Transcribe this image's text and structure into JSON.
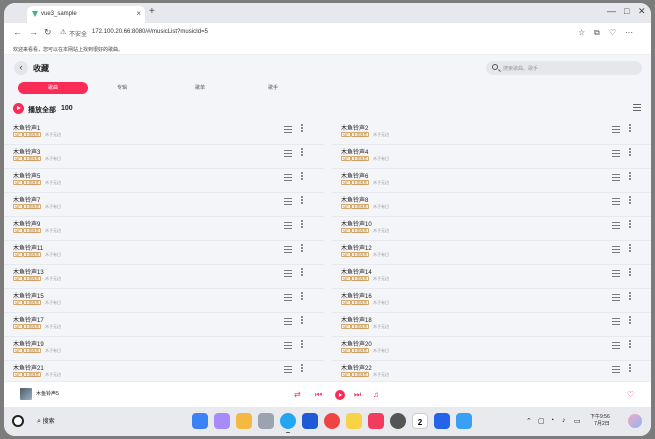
{
  "browser": {
    "tab_title": "vue3_sample",
    "tab_close": "×",
    "new_tab": "+",
    "insecure_label": "不安全",
    "url": "172.100.20.66:8080/#/musicList?musicId=5",
    "notice": "欢迎来看看，您可以在本网站上找到很好的歌曲。"
  },
  "header": {
    "back_glyph": "‹",
    "title": "收藏",
    "search_placeholder": "搜索歌曲、歌手"
  },
  "tabs": [
    "歌曲",
    "专辑",
    "歌单",
    "歌手"
  ],
  "play_all": {
    "label": "播放全部",
    "count": "100"
  },
  "songs": [
    {
      "name": "木鱼铃声1",
      "badge1": "VIP",
      "badge2": "无损音质",
      "album": "木子无边"
    },
    {
      "name": "木鱼铃声2",
      "badge1": "VIP",
      "badge2": "无损音质",
      "album": "木子无边"
    },
    {
      "name": "木鱼铃声3",
      "badge1": "VIP",
      "badge2": "无损音质",
      "album": "木子有日"
    },
    {
      "name": "木鱼铃声4",
      "badge1": "VIP",
      "badge2": "无损音质",
      "album": "木子有日"
    },
    {
      "name": "木鱼铃声5",
      "badge1": "VIP",
      "badge2": "无损音质",
      "album": "木子无边"
    },
    {
      "name": "木鱼铃声6",
      "badge1": "VIP",
      "badge2": "无损音质",
      "album": "木子无边"
    },
    {
      "name": "木鱼铃声7",
      "badge1": "VIP",
      "badge2": "无损音质",
      "album": "木子有日"
    },
    {
      "name": "木鱼铃声8",
      "badge1": "VIP",
      "badge2": "无损音质",
      "album": "木子有日"
    },
    {
      "name": "木鱼铃声9",
      "badge1": "VIP",
      "badge2": "无损音质",
      "album": "木子无边"
    },
    {
      "name": "木鱼铃声10",
      "badge1": "VIP",
      "badge2": "无损音质",
      "album": "木子无边"
    },
    {
      "name": "木鱼铃声11",
      "badge1": "VIP",
      "badge2": "无损音质",
      "album": "木子有日"
    },
    {
      "name": "木鱼铃声12",
      "badge1": "VIP",
      "badge2": "无损音质",
      "album": "木子有日"
    },
    {
      "name": "木鱼铃声13",
      "badge1": "VIP",
      "badge2": "无损音质",
      "album": "木子无边"
    },
    {
      "name": "木鱼铃声14",
      "badge1": "VIP",
      "badge2": "无损音质",
      "album": "木子无边"
    },
    {
      "name": "木鱼铃声15",
      "badge1": "VIP",
      "badge2": "无损音质",
      "album": "木子有日"
    },
    {
      "name": "木鱼铃声16",
      "badge1": "VIP",
      "badge2": "无损音质",
      "album": "木子有日"
    },
    {
      "name": "木鱼铃声17",
      "badge1": "VIP",
      "badge2": "无损音质",
      "album": "木子无边"
    },
    {
      "name": "木鱼铃声18",
      "badge1": "VIP",
      "badge2": "无损音质",
      "album": "木子无边"
    },
    {
      "name": "木鱼铃声19",
      "badge1": "VIP",
      "badge2": "无损音质",
      "album": "木子有日"
    },
    {
      "name": "木鱼铃声20",
      "badge1": "VIP",
      "badge2": "无损音质",
      "album": "木子有日"
    },
    {
      "name": "木鱼铃声21",
      "badge1": "VIP",
      "badge2": "无损音质",
      "album": "木子无边"
    },
    {
      "name": "木鱼铃声22",
      "badge1": "VIP",
      "badge2": "无损音质",
      "album": "木子无边"
    }
  ],
  "player": {
    "now_playing": "木鱼铃声5"
  },
  "taskbar": {
    "search_label": "搜索",
    "calendar_day": "2",
    "time": "下午9:56",
    "date": "7月2日"
  },
  "colors": {
    "accent": "#fa2c56"
  }
}
